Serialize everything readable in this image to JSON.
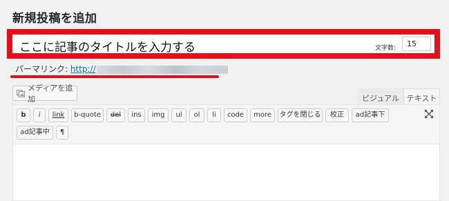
{
  "page": {
    "title": "新規投稿を追加"
  },
  "post_title": {
    "value": "ここに記事のタイトルを入力する",
    "counter_label": "文字数:",
    "counter_value": "15"
  },
  "permalink": {
    "label": "パーマリンク:",
    "link_text": "http://"
  },
  "media": {
    "button_label": "メディアを追加",
    "icon": "media-icon"
  },
  "editor_tabs": {
    "visual": "ビジュアル",
    "text": "テキスト"
  },
  "quicktags": {
    "row1": [
      "b",
      "i",
      "link",
      "b-quote",
      "del",
      "ins",
      "img",
      "ul",
      "ol",
      "li",
      "code",
      "more",
      "タグを閉じる",
      "校正",
      "ad記事下"
    ],
    "row2": [
      "ad記事中",
      "¶"
    ]
  },
  "toolbar": {
    "fullscreen_icon": "fullscreen-icon"
  },
  "colors": {
    "highlight_red": "#e3101c",
    "link_blue": "#0073aa"
  }
}
